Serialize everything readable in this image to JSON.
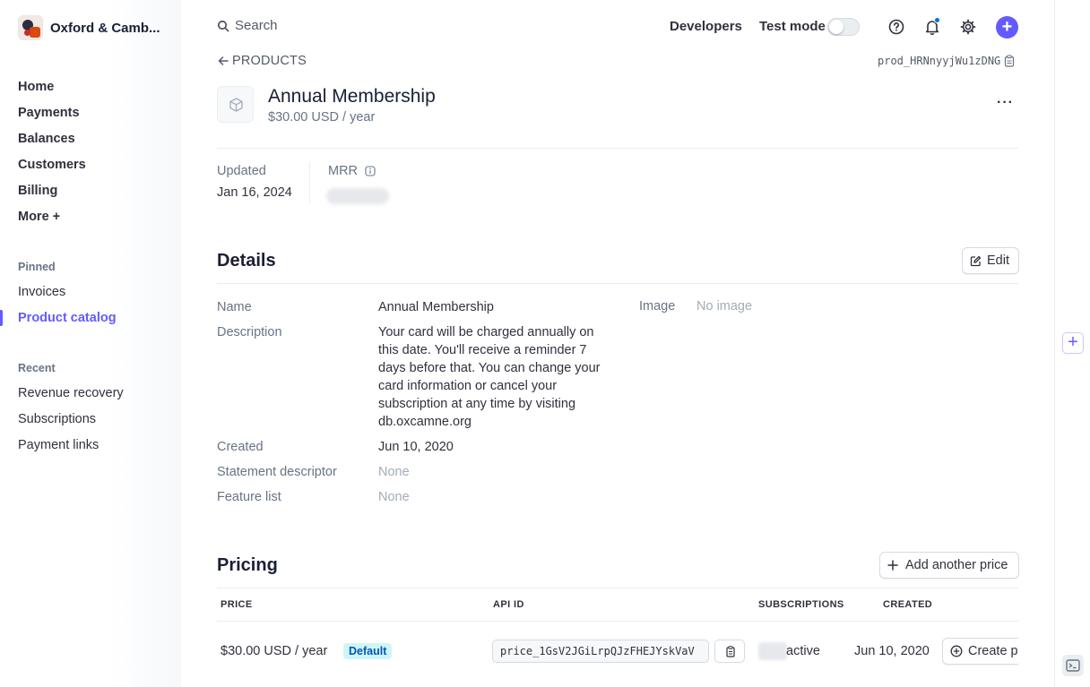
{
  "account": {
    "name": "Oxford & Camb..."
  },
  "nav": {
    "items": [
      {
        "label": "Home"
      },
      {
        "label": "Payments"
      },
      {
        "label": "Balances"
      },
      {
        "label": "Customers"
      },
      {
        "label": "Billing"
      },
      {
        "label": "More",
        "suffix": "+"
      }
    ],
    "pinned_label": "Pinned",
    "pinned": [
      {
        "label": "Invoices"
      },
      {
        "label": "Product catalog",
        "active": true
      }
    ],
    "recent_label": "Recent",
    "recent": [
      {
        "label": "Revenue recovery"
      },
      {
        "label": "Subscriptions"
      },
      {
        "label": "Payment links"
      }
    ]
  },
  "topbar": {
    "search_label": "Search",
    "developers_label": "Developers",
    "test_mode_label": "Test mode",
    "test_mode_on": false,
    "accent_color": "#635bff"
  },
  "product": {
    "breadcrumb": "PRODUCTS",
    "id": "prod_HRNnyyjWu1zDNG",
    "name": "Annual Membership",
    "price_summary": "$30.00 USD / year",
    "more_label": "···"
  },
  "meta": {
    "updated_label": "Updated",
    "updated_value": "Jan 16, 2024",
    "mrr_label": "MRR"
  },
  "details": {
    "title": "Details",
    "edit_label": "Edit",
    "name_label": "Name",
    "name_value": "Annual Membership",
    "description_label": "Description",
    "description_value": "Your card will be charged annually on this date. You'll receive a reminder 7 days before that. You can change your card information or cancel your subscription at any time by visiting db.oxcamne.org",
    "created_label": "Created",
    "created_value": "Jun 10, 2020",
    "statement_label": "Statement descriptor",
    "statement_value": "None",
    "feature_label": "Feature list",
    "feature_value": "None",
    "image_label": "Image",
    "image_value": "No image"
  },
  "pricing": {
    "title": "Pricing",
    "add_label": "Add another price",
    "columns": {
      "price": "PRICE",
      "api_id": "API ID",
      "subscriptions": "SUBSCRIPTIONS",
      "created": "CREATED"
    },
    "rows": [
      {
        "price": "$30.00 USD / year",
        "badge": "Default",
        "api_id": "price_1GsV2JGiLrpQJzFHEJYskVaV",
        "subscriptions": "active",
        "created": "Jun 10, 2020",
        "action": "Create p"
      }
    ]
  }
}
